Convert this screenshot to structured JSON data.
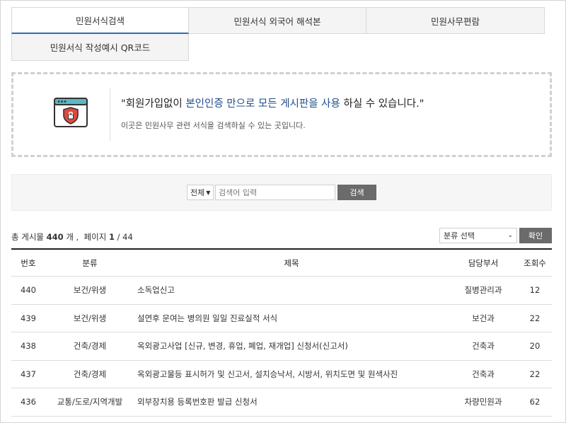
{
  "tabs": [
    {
      "label": "민원서식검색",
      "active": true
    },
    {
      "label": "민원서식 외국어 해석본",
      "active": false
    },
    {
      "label": "민원사무편람",
      "active": false
    },
    {
      "label": "민원서식 작성예시 QR코드",
      "active": false
    }
  ],
  "info": {
    "title_pre": "\"회원가입없이 ",
    "title_hl": "본인인증 만으로 모든 게시판을 사용",
    "title_post": " 하실 수 있습니다.\"",
    "subtitle": "이곳은 민원사무 관련 서식을 검색하실 수 있는 곳입니다."
  },
  "search": {
    "scope_value": "전체",
    "placeholder": "검색어 입력",
    "button_label": "검색"
  },
  "summary": {
    "total_prefix": "총 게시물",
    "total_count": "440",
    "total_unit": "개 ,",
    "page_prefix": "페이지",
    "current_page": "1",
    "total_pages": "/ 44"
  },
  "filter": {
    "category_value": "분류 선택",
    "confirm_label": "확인"
  },
  "table": {
    "headers": {
      "no": "번호",
      "category": "분류",
      "title": "제목",
      "dept": "담당부서",
      "views": "조회수"
    },
    "rows": [
      {
        "no": "440",
        "category": "보건/위생",
        "title": "소독업신고",
        "dept": "질병관리과",
        "views": "12"
      },
      {
        "no": "439",
        "category": "보건/위생",
        "title": "설연후 문여는 병의원 일일 진료실적 서식",
        "dept": "보건과",
        "views": "22"
      },
      {
        "no": "438",
        "category": "건축/경제",
        "title": "옥외광고사업 [신규, 변경, 휴업, 폐업, 재개업] 신청서(신고서)",
        "dept": "건축과",
        "views": "20"
      },
      {
        "no": "437",
        "category": "건축/경제",
        "title": "옥외광고물등 표시허가 및 신고서, 설치승낙서, 시방서, 위치도면 및 원색사진",
        "dept": "건축과",
        "views": "22"
      },
      {
        "no": "436",
        "category": "교통/도로/지역개발",
        "title": "외부장치용 등록번호판 발급 신청서",
        "dept": "차량민원과",
        "views": "62"
      }
    ]
  },
  "colors": {
    "accent": "#2f6db5",
    "highlight_text": "#1f4e8c",
    "button_bg": "#6b6b6b",
    "icon_red": "#e0483e",
    "icon_teal": "#5bb8c4"
  },
  "icons": {
    "info": "browser-shield-icon",
    "dropdown": "chevron-down-icon"
  }
}
